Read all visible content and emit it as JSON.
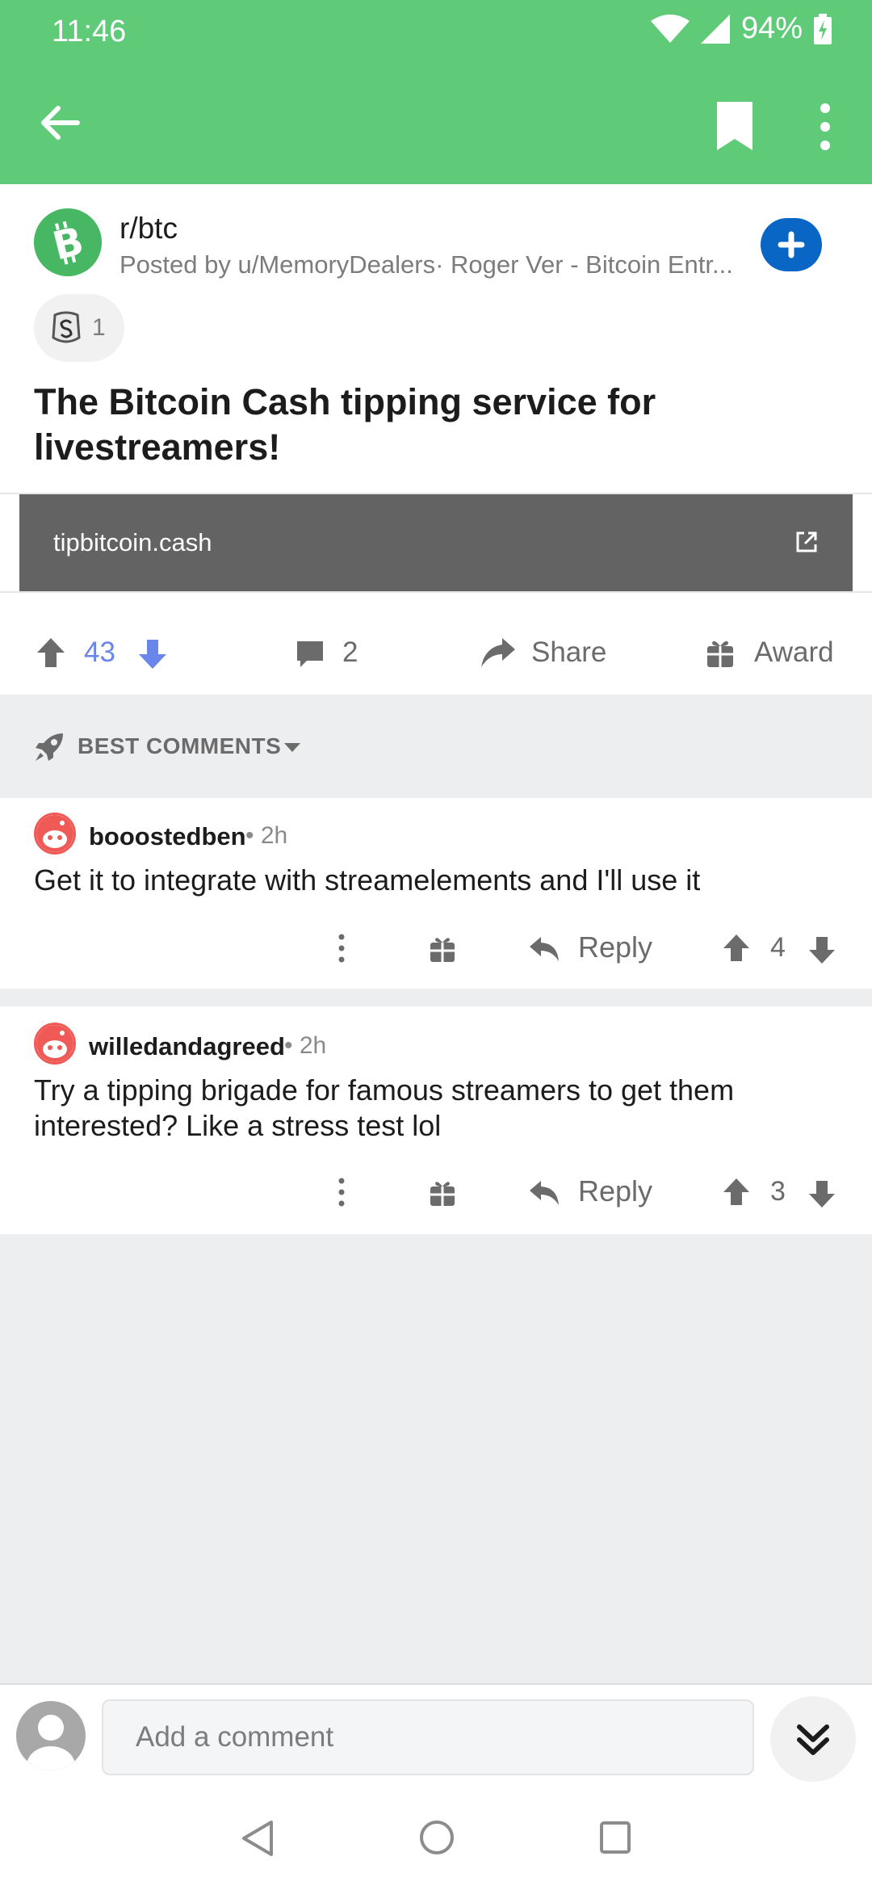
{
  "status_bar": {
    "time": "11:46",
    "battery": "94%"
  },
  "post": {
    "subreddit": "r/btc",
    "posted_by": "Posted by u/MemoryDealers· Roger Ver - Bitcoin Entr...",
    "award_count": "1",
    "title": "The Bitcoin Cash tipping service for livestreamers!",
    "link_domain": "tipbitcoin.cash",
    "score": "43",
    "comment_count": "2",
    "share_label": "Share",
    "award_label": "Award"
  },
  "sort": {
    "label": "BEST COMMENTS"
  },
  "comments": [
    {
      "author": "booostedben",
      "time": "• 2h",
      "body": "Get it to integrate with streamelements and I'll use it",
      "reply_label": "Reply",
      "score": "4"
    },
    {
      "author": "willedandagreed",
      "time": "• 2h",
      "body": "Try a tipping brigade for famous streamers to get them interested? Like a stress test lol",
      "reply_label": "Reply",
      "score": "3"
    }
  ],
  "composer": {
    "placeholder": "Add a comment"
  },
  "colors": {
    "header": "#5fcb79",
    "upvote_active": "#6a86ea",
    "join_button": "#0a66c5",
    "link_bar": "#636363"
  },
  "icons": [
    "back-arrow-icon",
    "bookmark-icon",
    "more-vert-icon",
    "bitcoin-cash-icon",
    "plus-icon",
    "silver-award-icon",
    "external-link-icon",
    "upvote-icon",
    "downvote-icon",
    "comment-icon",
    "share-icon",
    "gift-icon",
    "rocket-icon",
    "caret-down-icon",
    "reply-icon",
    "snoo-avatar-icon",
    "user-avatar-icon",
    "double-chevron-down-icon"
  ]
}
